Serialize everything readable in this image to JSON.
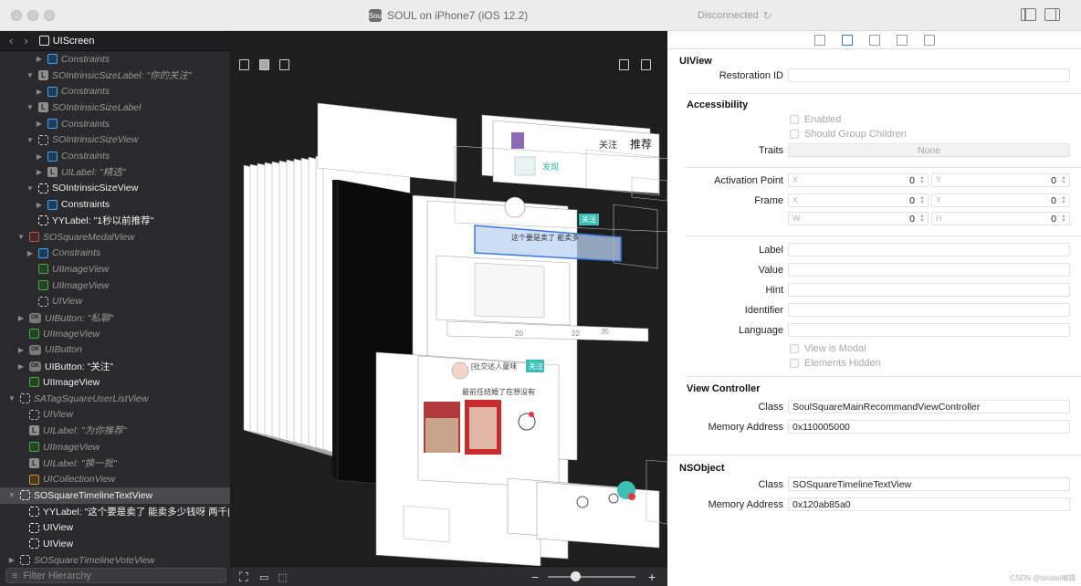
{
  "window": {
    "title": "SOUL on iPhone7 (iOS 12.2)",
    "status": "Disconnected",
    "app_icon_glyph": "Sou"
  },
  "navigator": {
    "breadcrumb": "UIScreen",
    "filter_placeholder": "Filter Hierarchy",
    "rows": [
      {
        "indent": 3,
        "disc": "▶",
        "icon": "c",
        "label": "Constraints",
        "style": "italic"
      },
      {
        "indent": 2,
        "disc": "▼",
        "icon": "l",
        "label": "SOIntrinsicSizeLabel: \"你的关注\"",
        "style": "italic"
      },
      {
        "indent": 3,
        "disc": "▶",
        "icon": "c",
        "label": "Constraints",
        "style": "italic"
      },
      {
        "indent": 2,
        "disc": "▼",
        "icon": "l",
        "label": "SOIntrinsicSizeLabel",
        "style": "italic"
      },
      {
        "indent": 3,
        "disc": "▶",
        "icon": "c",
        "label": "Constraints",
        "style": "italic"
      },
      {
        "indent": 2,
        "disc": "▼",
        "icon": "v",
        "label": "SOIntrinsicSizeView",
        "style": "italic"
      },
      {
        "indent": 3,
        "disc": "▶",
        "icon": "c",
        "label": "Constraints",
        "style": "italic"
      },
      {
        "indent": 3,
        "disc": "▶",
        "icon": "l",
        "label": "UILabel: \"精选\"",
        "style": "italic"
      },
      {
        "indent": 2,
        "disc": "▼",
        "icon": "vs",
        "label": "SOIntrinsicSizeView",
        "style": "bright"
      },
      {
        "indent": 3,
        "disc": "▶",
        "icon": "c",
        "label": "Constraints",
        "style": "bright"
      },
      {
        "indent": 2,
        "disc": "",
        "icon": "vs",
        "label": "YYLabel: \"1秒以前推荐\"",
        "style": "bright"
      },
      {
        "indent": 1,
        "disc": "▼",
        "icon": "red",
        "label": "SOSquareMedalView",
        "style": "italic"
      },
      {
        "indent": 2,
        "disc": "▶",
        "icon": "c",
        "label": "Constraints",
        "style": "italic"
      },
      {
        "indent": 2,
        "disc": "",
        "icon": "img",
        "label": "UIImageView",
        "style": "italic"
      },
      {
        "indent": 2,
        "disc": "",
        "icon": "img",
        "label": "UIImageView",
        "style": "italic"
      },
      {
        "indent": 2,
        "disc": "",
        "icon": "v",
        "label": "UIView",
        "style": "italic"
      },
      {
        "indent": 1,
        "disc": "▶",
        "icon": "btn",
        "label": "UIButton: \"私聊\"",
        "style": "italic"
      },
      {
        "indent": 1,
        "disc": "",
        "icon": "img",
        "label": "UIImageView",
        "style": "italic"
      },
      {
        "indent": 1,
        "disc": "▶",
        "icon": "btn",
        "label": "UIButton",
        "style": "italic"
      },
      {
        "indent": 1,
        "disc": "▶",
        "icon": "btn",
        "label": "UIButton: \"关注\"",
        "style": "bright"
      },
      {
        "indent": 1,
        "disc": "",
        "icon": "img",
        "label": "UIImageView",
        "style": "bright"
      },
      {
        "indent": 0,
        "disc": "▼",
        "icon": "v",
        "label": "SATagSquareUserListView",
        "style": "italic"
      },
      {
        "indent": 1,
        "disc": "",
        "icon": "v",
        "label": "UIView",
        "style": "italic"
      },
      {
        "indent": 1,
        "disc": "",
        "icon": "l",
        "label": "UILabel: \"为你推荐\"",
        "style": "italic"
      },
      {
        "indent": 1,
        "disc": "",
        "icon": "img",
        "label": "UIImageView",
        "style": "italic"
      },
      {
        "indent": 1,
        "disc": "",
        "icon": "l",
        "label": "UILabel: \"换一批\"",
        "style": "italic"
      },
      {
        "indent": 1,
        "disc": "",
        "icon": "col",
        "label": "UICollectionView",
        "style": "italic"
      },
      {
        "indent": 0,
        "disc": "▼",
        "icon": "vs",
        "label": "SOSquareTimelineTextView",
        "style": "bright",
        "selected": true
      },
      {
        "indent": 1,
        "disc": "",
        "icon": "vs",
        "label": "YYLabel: \"这个要是卖了 能卖多少钱呀 两千|",
        "style": "bright"
      },
      {
        "indent": 1,
        "disc": "",
        "icon": "vs",
        "label": "UIView",
        "style": "bright"
      },
      {
        "indent": 1,
        "disc": "",
        "icon": "vs",
        "label": "UIView",
        "style": "bright"
      },
      {
        "indent": 0,
        "disc": "▶",
        "icon": "v",
        "label": "SOSquareTimelineVoteView",
        "style": "italic"
      }
    ]
  },
  "canvas": {
    "card_texts": {
      "follow": "关注",
      "recommend": "推荐",
      "discover": "发现",
      "selected_text": "这个要是卖了 能卖多",
      "follow_badge": "关注",
      "follow_badge2": "关注",
      "count1": "20",
      "count2": "22",
      "count3": "35",
      "post_text": "[社交达人童味",
      "post_text2": "最前任结婚了在想没有"
    }
  },
  "inspector": {
    "uiview": {
      "section": "UIView",
      "restoration_id_label": "Restoration ID",
      "restoration_id_value": ""
    },
    "accessibility": {
      "section": "Accessibility",
      "enabled_label": "Enabled",
      "group_children_label": "Should Group Children",
      "traits_label": "Traits",
      "traits_value": "None",
      "activation_point_label": "Activation Point",
      "frame_label": "Frame",
      "activation_x": "0",
      "activation_y": "0",
      "frame_x": "0",
      "frame_y": "0",
      "frame_w": "0",
      "frame_h": "0",
      "axis_x": "X",
      "axis_y": "Y",
      "axis_w": "W",
      "axis_h": "H",
      "label_label": "Label",
      "value_label": "Value",
      "hint_label": "Hint",
      "identifier_label": "Identifier",
      "language_label": "Language",
      "view_modal_label": "View is Modal",
      "elements_hidden_label": "Elements Hidden"
    },
    "view_controller": {
      "section": "View Controller",
      "class_label": "Class",
      "class_value": "SoulSquareMainRecommandViewController",
      "address_label": "Memory Address",
      "address_value": "0x110005000"
    },
    "nsobject": {
      "section": "NSObject",
      "class_label": "Class",
      "class_value": "SOSquareTimelineTextView",
      "address_label": "Memory Address",
      "address_value": "0x120ab85a0"
    },
    "watermark": "CSDN @bindsii编辑"
  }
}
